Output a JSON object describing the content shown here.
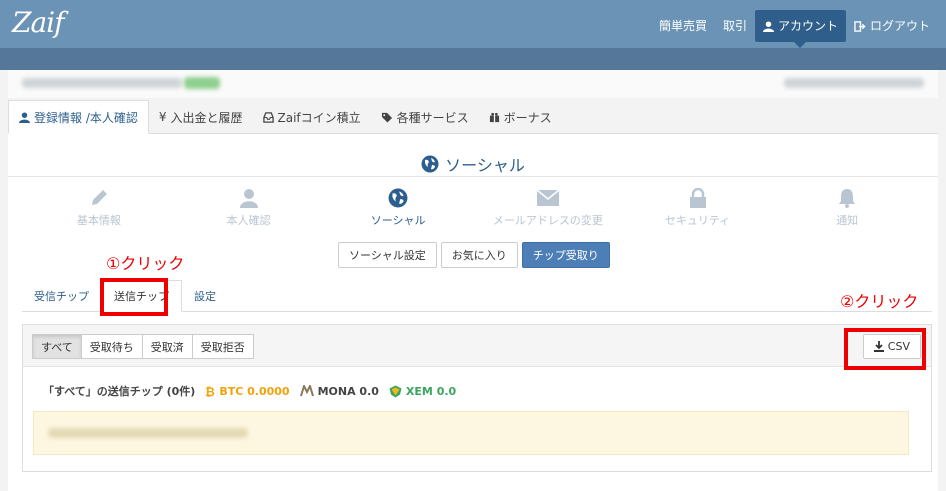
{
  "header": {
    "logo": "Zaif",
    "nav": [
      {
        "label": "簡単売買",
        "icon": ""
      },
      {
        "label": "取引",
        "icon": ""
      },
      {
        "label": "アカウント",
        "icon": "user-icon"
      },
      {
        "label": "ログアウト",
        "icon": "logout-icon"
      }
    ]
  },
  "tabs": [
    {
      "label": "登録情報 /本人確認",
      "icon": "user-icon"
    },
    {
      "label": "入出金と履歴",
      "icon": "yen-icon"
    },
    {
      "label": "Zaifコイン積立",
      "icon": "inbox-icon"
    },
    {
      "label": "各種サービス",
      "icon": "tags-icon"
    },
    {
      "label": "ボーナス",
      "icon": "gift-icon"
    }
  ],
  "section_title": "ソーシャル",
  "steps": [
    {
      "label": "基本情報",
      "icon": "pencil-icon"
    },
    {
      "label": "本人確認",
      "icon": "user-icon"
    },
    {
      "label": "ソーシャル",
      "icon": "globe-icon"
    },
    {
      "label": "メールアドレスの変更",
      "icon": "envelope-icon"
    },
    {
      "label": "セキュリティ",
      "icon": "lock-icon"
    },
    {
      "label": "通知",
      "icon": "bell-icon"
    }
  ],
  "social_buttons": [
    "ソーシャル設定",
    "お気に入り",
    "チップ受取り"
  ],
  "annotations": {
    "step1": "①クリック",
    "step2": "②クリック"
  },
  "subtabs": [
    "受信チップ",
    "送信チップ",
    "設定"
  ],
  "filters": [
    "すべて",
    "受取待ち",
    "受取済",
    "受取拒否"
  ],
  "csv_label": "CSV",
  "summary": {
    "label": "「すべて」の送信チップ (0件)",
    "btc": "BTC 0.0000",
    "mona": "MONA 0.0",
    "xem": "XEM 0.0"
  },
  "colors": {
    "header": "#6a93b5",
    "accent": "#2d5f8e",
    "btc": "#f0a30a",
    "mona": "#8a7a5a",
    "xem": "#3aa55d",
    "annotation": "#ee0000"
  }
}
